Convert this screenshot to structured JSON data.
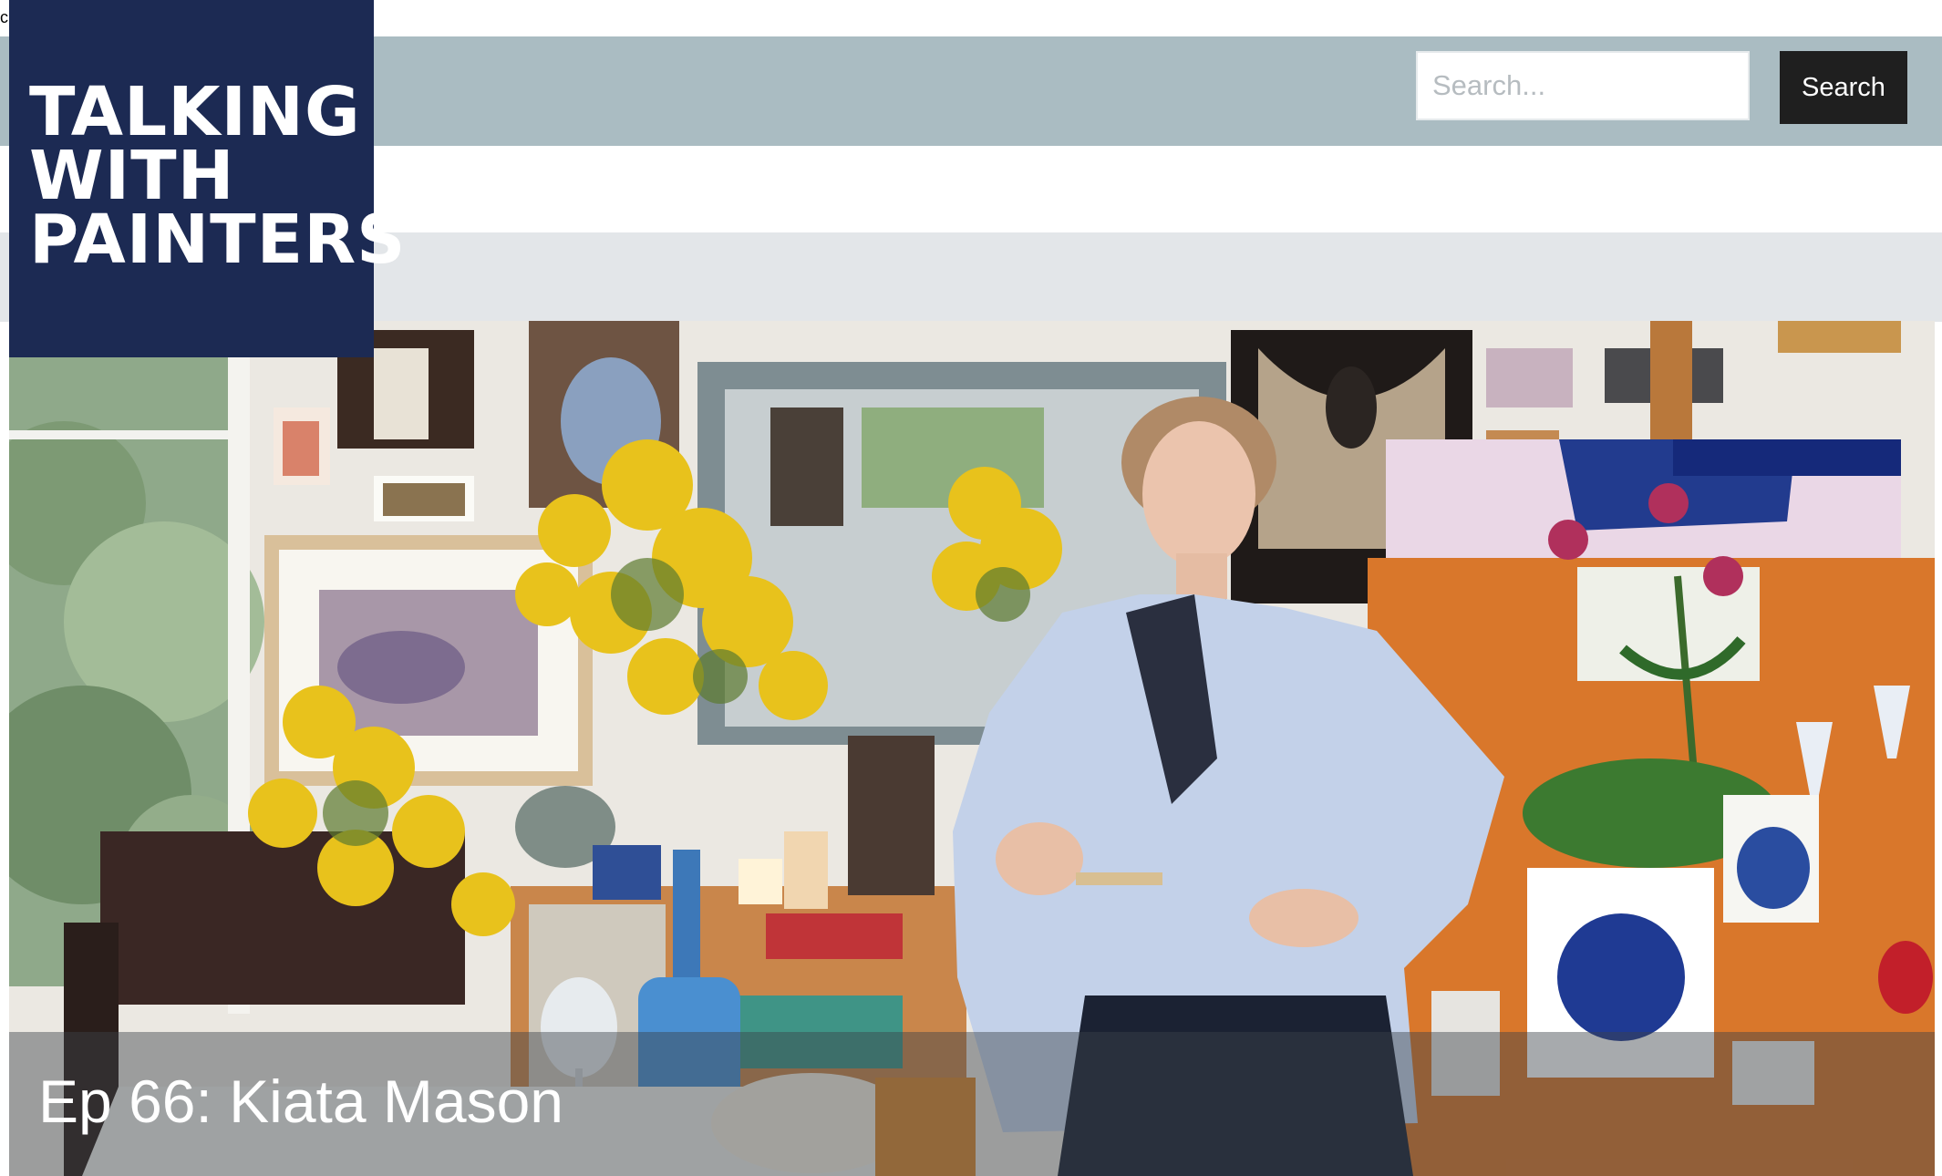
{
  "site": {
    "logo_lines": [
      "TALKING",
      "WITH",
      "PAINTERS"
    ]
  },
  "search": {
    "placeholder": "Search...",
    "button_label": "Search"
  },
  "hero": {
    "episode_title": "Ep 66: Kiata Mason"
  },
  "colors": {
    "header_bar": "#aabcc2",
    "logo_background": "#1c2a53",
    "search_button": "#1f1f1f",
    "band": "#e3e6e9"
  }
}
